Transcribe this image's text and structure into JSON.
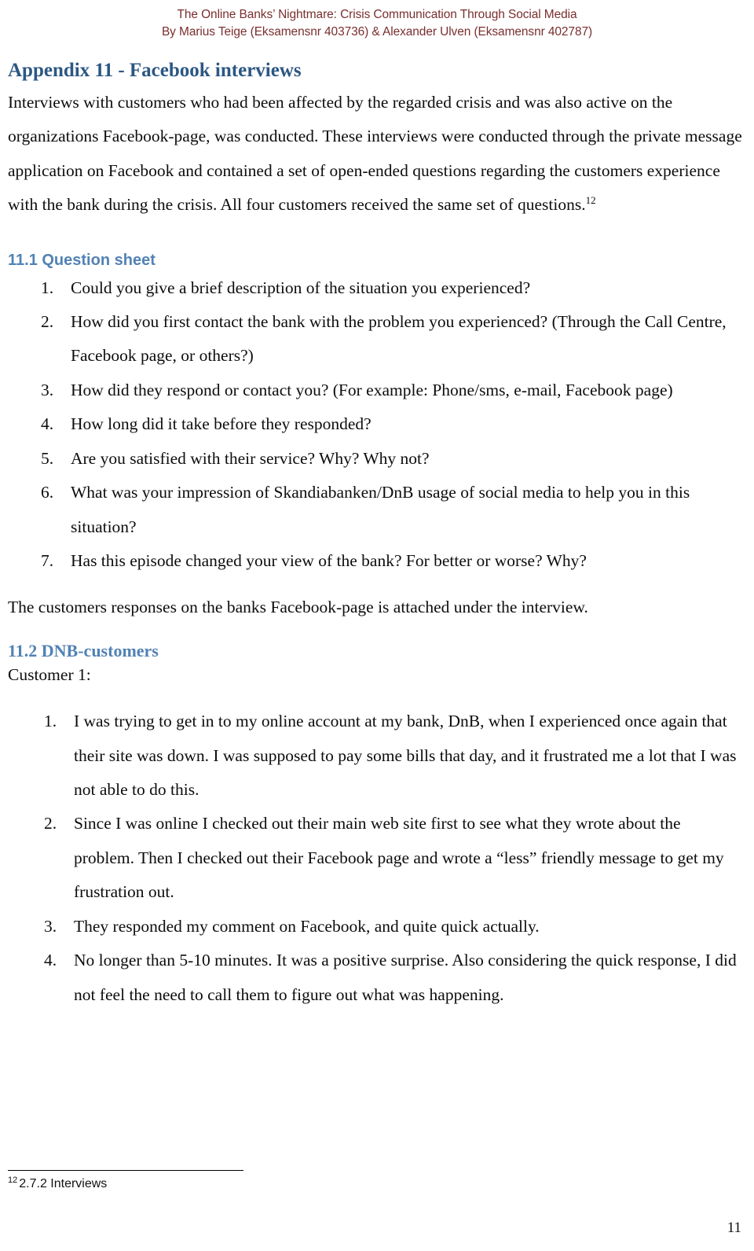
{
  "header": {
    "line1": "The Online Banks’ Nightmare: Crisis Communication Through Social Media",
    "line2": "By Marius Teige (Eksamensnr 403736) & Alexander Ulven (Eksamensnr 402787)",
    "color": "#7a2f2f"
  },
  "appendix": {
    "title": "Appendix 11 - Facebook interviews",
    "title_color": "#2c5783",
    "intro": "Interviews with customers who had been affected by the regarded crisis and was also active on the organizations Facebook-page, was conducted. These interviews were conducted through the private message application on Facebook and contained a set of open-ended questions regarding the customers experience with the bank during the crisis. All four customers received the same set of questions.",
    "intro_footnote_marker": "12"
  },
  "section_11_1": {
    "heading": "11.1 Question sheet",
    "heading_color": "#5282b4",
    "questions": [
      "Could you give a brief description of the situation you experienced?",
      "How did you first contact the bank with the problem you experienced? (Through the Call Centre, Facebook page, or others?)",
      "How did they respond or contact you? (For example: Phone/sms, e-mail, Facebook page)",
      "How long did it take before they responded?",
      "Are you satisfied with their service? Why? Why not?",
      "What was your impression of Skandiabanken/DnB usage of social media to help you in this situation?",
      "Has this episode changed your view of the bank? For better or worse? Why?"
    ],
    "closing_note": "The customers responses on the banks Facebook-page is attached under the interview."
  },
  "section_11_2": {
    "heading": "11.2 DNB-customers",
    "heading_color": "#5282b4",
    "customer_label": "Customer 1:",
    "answers": [
      "I was trying to get in to my online account at my bank, DnB, when I experienced once again that their site was down. I was supposed to pay some bills that day, and it frustrated me a lot that I was not able to do this.",
      "Since I was online I checked out their main web site first to see what they wrote about the problem. Then I checked out their Facebook page and wrote a “less” friendly message to get my frustration out.",
      "They responded my comment on Facebook, and quite quick actually.",
      "No longer than 5-10 minutes. It was a positive surprise. Also considering the quick response, I did not feel the need to call them to figure out what was happening."
    ]
  },
  "footnote": {
    "marker": "12",
    "text": "2.7.2 Interviews"
  },
  "page_number": "11"
}
